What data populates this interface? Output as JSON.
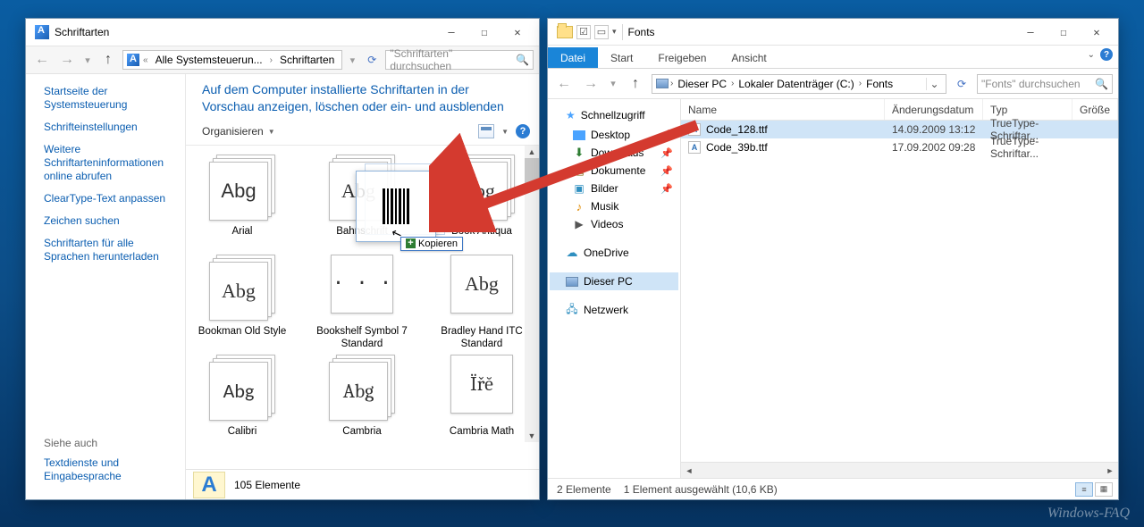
{
  "fontsWindow": {
    "title": "Schriftarten",
    "breadcrumb": {
      "prefix": "«",
      "parent": "Alle Systemsteuerun...",
      "current": "Schriftarten"
    },
    "searchPlaceholder": "\"Schriftarten\" durchsuchen",
    "sidebar": {
      "home": "Startseite der Systemsteuerung",
      "links": [
        "Schrifteinstellungen",
        "Weitere Schriftarteninformationen online abrufen",
        "ClearType-Text anpassen",
        "Zeichen suchen",
        "Schriftarten für alle Sprachen herunterladen"
      ],
      "seeAlsoHeader": "Siehe auch",
      "seeAlso": "Textdienste und Eingabesprache"
    },
    "heading": "Auf dem Computer installierte Schriftarten in der Vorschau anzeigen, löschen oder ein- und ausblenden",
    "organize": "Organisieren",
    "fonts": [
      {
        "name": "Arial",
        "sample": "Abg",
        "stack": true,
        "sampleFont": "Arial"
      },
      {
        "name": "Bahnschrift",
        "sample": "Abg",
        "stack": true,
        "sampleFont": "Arial Narrow"
      },
      {
        "name": "Book Antiqua",
        "sample": "Abg",
        "stack": true,
        "sampleFont": "Georgia"
      },
      {
        "name": "Bookman Old Style",
        "sample": "Abg",
        "stack": true,
        "sampleFont": "Georgia"
      },
      {
        "name": "Bookshelf Symbol 7 Standard",
        "sample": "·  ·   ·",
        "stack": false,
        "sampleFont": "monospace"
      },
      {
        "name": "Bradley Hand ITC Standard",
        "sample": "Abg",
        "stack": false,
        "sampleFont": "cursive"
      },
      {
        "name": "Calibri",
        "sample": "Abg",
        "stack": true,
        "sampleFont": "Calibri, Arial"
      },
      {
        "name": "Cambria",
        "sample": "Abg",
        "stack": true,
        "sampleFont": "Cambria, Georgia"
      },
      {
        "name": "Cambria Math",
        "sample": "Ïřĕ",
        "stack": false,
        "sampleFont": "Cambria, Georgia"
      }
    ],
    "dragTooltip": "Kopieren",
    "statusCount": "105 Elemente"
  },
  "explorerWindow": {
    "title": "Fonts",
    "tabs": [
      "Datei",
      "Start",
      "Freigeben",
      "Ansicht"
    ],
    "breadcrumb": [
      "Dieser PC",
      "Lokaler Datenträger (C:)",
      "Fonts"
    ],
    "searchPlaceholder": "\"Fonts\" durchsuchen",
    "tree": {
      "quickAccess": "Schnellzugriff",
      "items": [
        {
          "label": "Desktop",
          "icon": "desktop",
          "pinned": true
        },
        {
          "label": "Downloads",
          "icon": "dl",
          "pinned": true
        },
        {
          "label": "Dokumente",
          "icon": "doc",
          "pinned": true
        },
        {
          "label": "Bilder",
          "icon": "pic",
          "pinned": true
        },
        {
          "label": "Musik",
          "icon": "music",
          "pinned": false
        },
        {
          "label": "Videos",
          "icon": "video",
          "pinned": false
        }
      ],
      "oneDrive": "OneDrive",
      "thisPC": "Dieser PC",
      "network": "Netzwerk"
    },
    "columns": {
      "name": "Name",
      "date": "Änderungsdatum",
      "type": "Typ",
      "size": "Größe"
    },
    "files": [
      {
        "name": "Code_128.ttf",
        "date": "14.09.2009 13:12",
        "type": "TrueType-Schriftar...",
        "selected": true
      },
      {
        "name": "Code_39b.ttf",
        "date": "17.09.2002 09:28",
        "type": "TrueType-Schriftar...",
        "selected": false
      }
    ],
    "status": {
      "count": "2 Elemente",
      "selection": "1 Element ausgewählt (10,6 KB)"
    }
  },
  "watermark": "Windows-FAQ"
}
